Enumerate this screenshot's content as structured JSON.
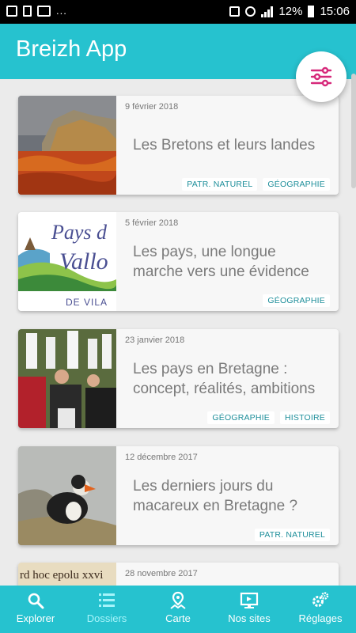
{
  "status_bar": {
    "battery": "12%",
    "time": "15:06",
    "dots": "..."
  },
  "app": {
    "title": "Breizh App"
  },
  "articles": [
    {
      "date": "9 février 2018",
      "title": "Les Bretons et leurs landes",
      "tags": [
        "PATR. NATUREL",
        "GÉOGRAPHIE"
      ]
    },
    {
      "date": "5 février 2018",
      "title": "Les pays, une longue marche vers une évidence",
      "tags": [
        "GÉOGRAPHIE"
      ],
      "image_text": {
        "line1": "Pays d",
        "line2": "Vallo",
        "line3": "DE VILA"
      }
    },
    {
      "date": "23 janvier 2018",
      "title": "Les pays en Bretagne : concept, réalités, ambitions",
      "tags": [
        "GÉOGRAPHIE",
        "HISTOIRE"
      ]
    },
    {
      "date": "12 décembre 2017",
      "title": "Les derniers jours du macareux en Bretagne ?",
      "tags": [
        "PATR. NATUREL"
      ]
    },
    {
      "date": "28 novembre 2017",
      "title": "",
      "tags": [],
      "image_text": {
        "line1": "rd hoc epolu xxvi"
      }
    }
  ],
  "nav": {
    "items": [
      {
        "label": "Explorer",
        "icon": "search-icon"
      },
      {
        "label": "Dossiers",
        "icon": "list-icon"
      },
      {
        "label": "Carte",
        "icon": "map-pin-icon"
      },
      {
        "label": "Nos sites",
        "icon": "monitor-icon"
      },
      {
        "label": "Réglages",
        "icon": "gears-icon"
      }
    ],
    "active": "Dossiers"
  },
  "colors": {
    "primary": "#26c2cf",
    "accent": "#d6287a",
    "tag_text": "#1d8e9a",
    "nav_active": "#a6f4fa"
  }
}
